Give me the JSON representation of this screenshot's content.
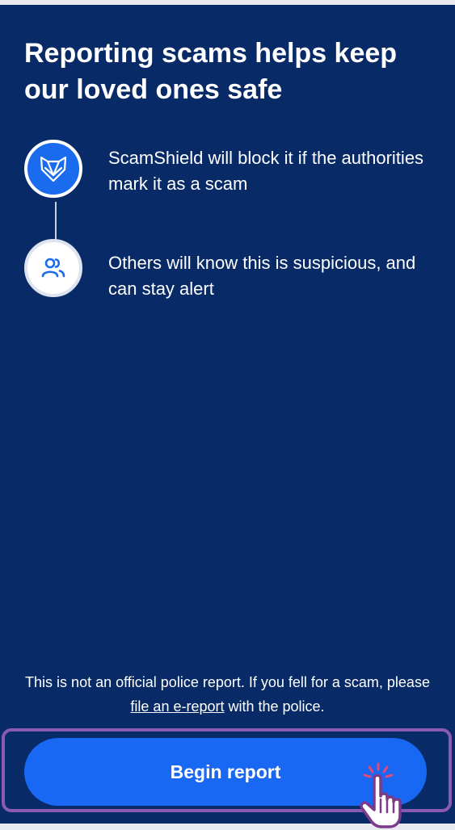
{
  "header": {
    "title": "Reporting scams helps keep our loved ones safe"
  },
  "steps": [
    {
      "icon": "scamshield-fox-icon",
      "text": "ScamShield will block it if the authorities mark it as a scam"
    },
    {
      "icon": "people-icon",
      "text": "Others will know this is suspicious, and can stay alert"
    }
  ],
  "disclaimer": {
    "before": "This is not an official police report. If you fell for a scam, please ",
    "link": "file an e-report",
    "after": " with the police."
  },
  "cta": {
    "label": "Begin report"
  },
  "colors": {
    "background": "#082a67",
    "accent": "#1868f3",
    "highlight": "#8a5ab0"
  }
}
